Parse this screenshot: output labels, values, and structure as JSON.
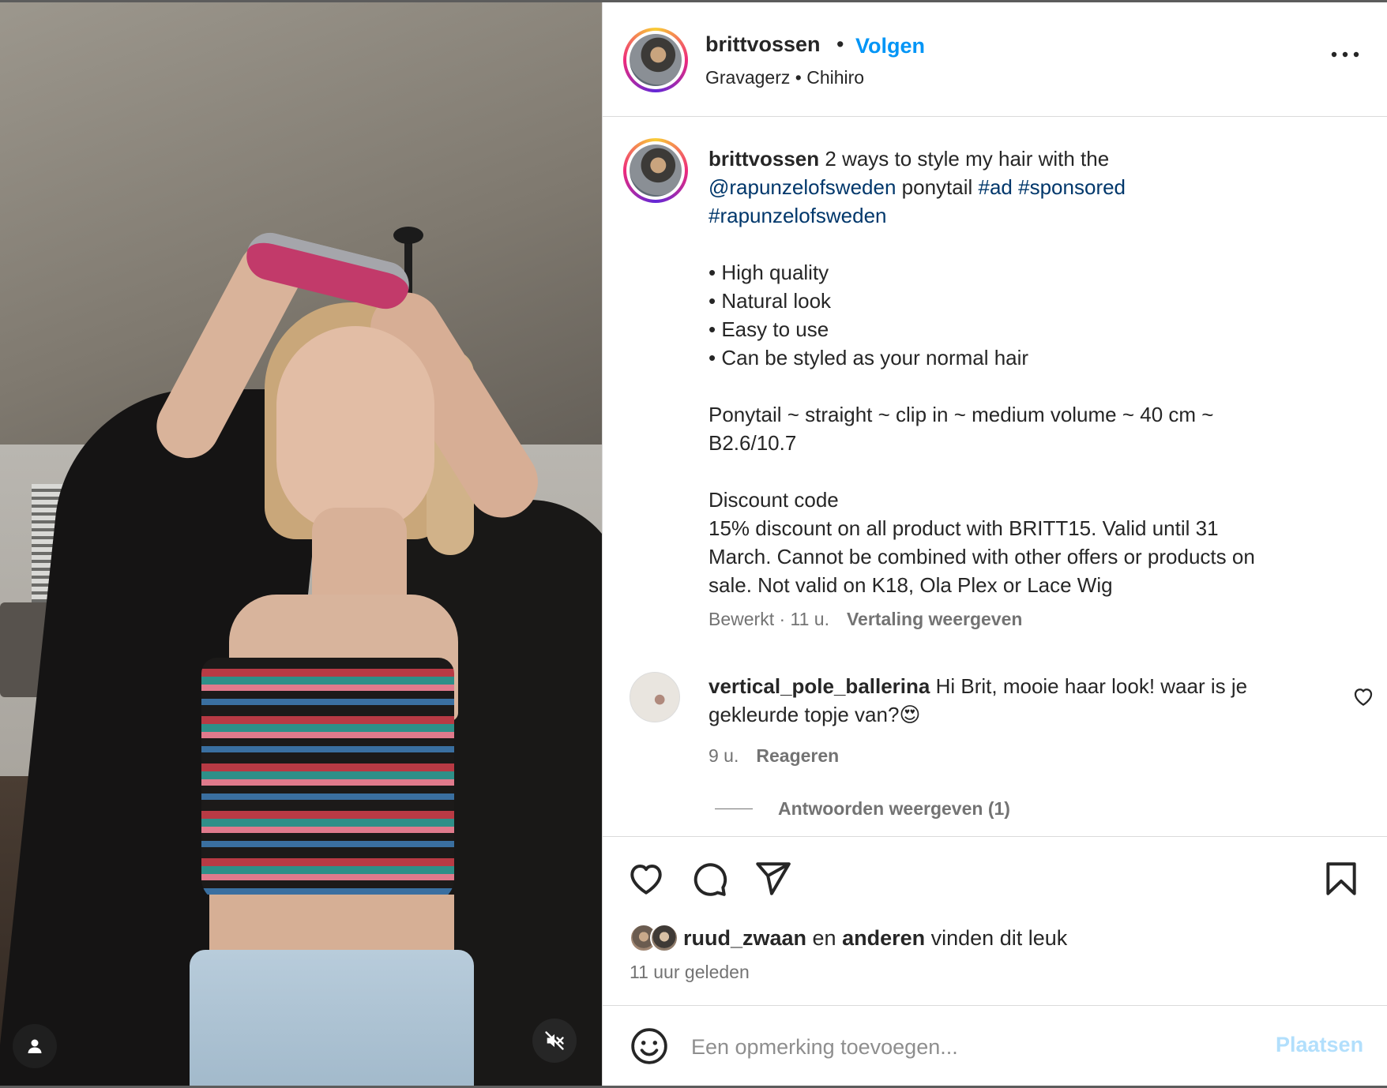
{
  "header": {
    "username": "brittvossen",
    "separator": "•",
    "follow_label": "Volgen",
    "audio": "Gravagerz • Chihiro"
  },
  "caption": {
    "username": "brittvossen",
    "intro": " 2 ways to style my hair with the",
    "mention": "@rapunzelofsweden",
    "ponytail_word": " ponytail ",
    "tag_ad": "#ad",
    "tag_sponsored": "#sponsored",
    "tag_brand": "#rapunzelofsweden",
    "bullets": [
      "• High quality",
      "• Natural look",
      "• Easy to use",
      "• Can be styled as your normal hair"
    ],
    "product_line1": "Ponytail ~ straight ~ clip in ~ medium volume ~ 40 cm ~",
    "product_line2": "B2.6/10.7",
    "discount_title": "Discount code",
    "discount_line1": "15% discount on all product with BRITT15. Valid until 31",
    "discount_line2": "March. Cannot be combined with other offers or products on",
    "discount_line3": "sale. Not valid on K18, Ola Plex or Lace Wig",
    "meta": "Bewerkt · 11 u.",
    "translate_label": "Vertaling weergeven"
  },
  "comment": {
    "username": "vertical_pole_ballerina",
    "text": " Hi Brit, mooie haar look! waar is je gekleurde topje van?😍",
    "time": "9 u.",
    "reply_label": "Reageren",
    "view_replies_label": "Antwoorden weergeven (1)"
  },
  "likes": {
    "first_user": "ruud_zwaan",
    "connector": " en ",
    "others": "anderen",
    "suffix": " vinden dit leuk",
    "time_ago": "11 uur geleden"
  },
  "add_comment": {
    "placeholder": "Een opmerking toevoegen...",
    "post_label": "Plaatsen"
  },
  "colors": {
    "accent_blue": "#0095f6",
    "link_blue": "#00376b",
    "muted_text": "#737373",
    "post_disabled": "#b2dffc"
  },
  "icons": {
    "more": "more-horizontal-icon",
    "like": "heart-icon",
    "comment": "comment-bubble-icon",
    "share": "paper-plane-icon",
    "save": "bookmark-icon",
    "emoji": "smiley-icon",
    "user_tag": "user-icon",
    "mute": "speaker-muted-icon"
  }
}
